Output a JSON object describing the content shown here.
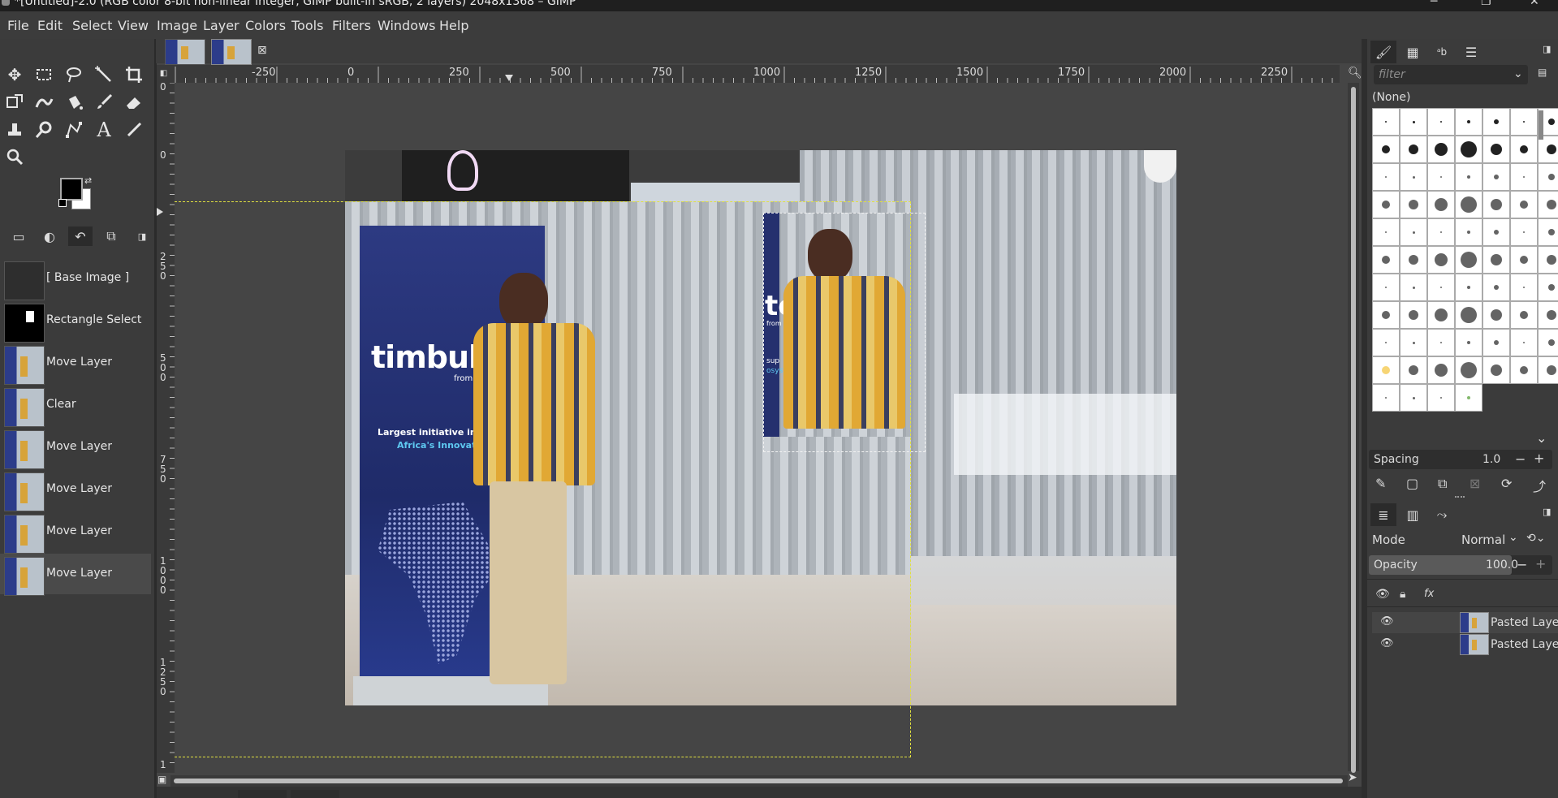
{
  "window": {
    "title": "*[Untitled]-2.0 (RGB color 8-bit non-linear integer, GIMP built-in sRGB, 2 layers) 2048x1368 – GIMP"
  },
  "menu": [
    "File",
    "Edit",
    "Select",
    "View",
    "Image",
    "Layer",
    "Colors",
    "Tools",
    "Filters",
    "Windows",
    "Help"
  ],
  "toolbox": {
    "tools": [
      "move-tool",
      "rectangle-select-tool",
      "free-select-tool",
      "fuzzy-select-tool",
      "crop-tool",
      "unified-transform-tool",
      "warp-transform-tool",
      "bucket-fill-tool",
      "paintbrush-tool",
      "eraser-tool",
      "clone-tool",
      "smudge-tool",
      "paths-tool",
      "text-tool",
      "color-picker-tool",
      "zoom-tool"
    ],
    "fg_color": "#000000",
    "bg_color": "#ffffff"
  },
  "undo_history": [
    {
      "label": "[ Base Image ]",
      "thumb": "base"
    },
    {
      "label": "Rectangle Select",
      "thumb": "select"
    },
    {
      "label": "Move Layer",
      "thumb": "photo"
    },
    {
      "label": "Clear",
      "thumb": "photo"
    },
    {
      "label": "Move Layer",
      "thumb": "photo"
    },
    {
      "label": "Move Layer",
      "thumb": "photo"
    },
    {
      "label": "Move Layer",
      "thumb": "photo"
    },
    {
      "label": "Move Layer",
      "thumb": "photo"
    }
  ],
  "rulers": {
    "horizontal": [
      "-250",
      "0",
      "250",
      "500",
      "750",
      "1000",
      "1250",
      "1500",
      "1750",
      "2000",
      "2250"
    ],
    "vertical_digits": [
      "0",
      "0",
      "2 5 0",
      "5 0 0",
      "7 5 0",
      "1 0 0 0",
      "1 2 5 0",
      "1"
    ]
  },
  "canvas": {
    "banner_brand": "timbukto",
    "banner_tagline": "from here to Africa",
    "banner_line1": "Largest initiative in the world sup",
    "banner_line2": "Africa's Innovation Ecosyst",
    "floating_brand": "to",
    "floating_tagline": "from here to Afric",
    "floating_sub": "sup",
    "floating_sub2": "osyst"
  },
  "brushes": {
    "filter_placeholder": "filter",
    "selected_name": "(None)",
    "spacing_label": "Spacing",
    "spacing_value": "1.0"
  },
  "layers": {
    "mode_label": "Mode",
    "mode_value": "Normal",
    "opacity_label": "Opacity",
    "opacity_value": "100.0",
    "items": [
      "Pasted Layer",
      "Pasted Layer"
    ]
  }
}
